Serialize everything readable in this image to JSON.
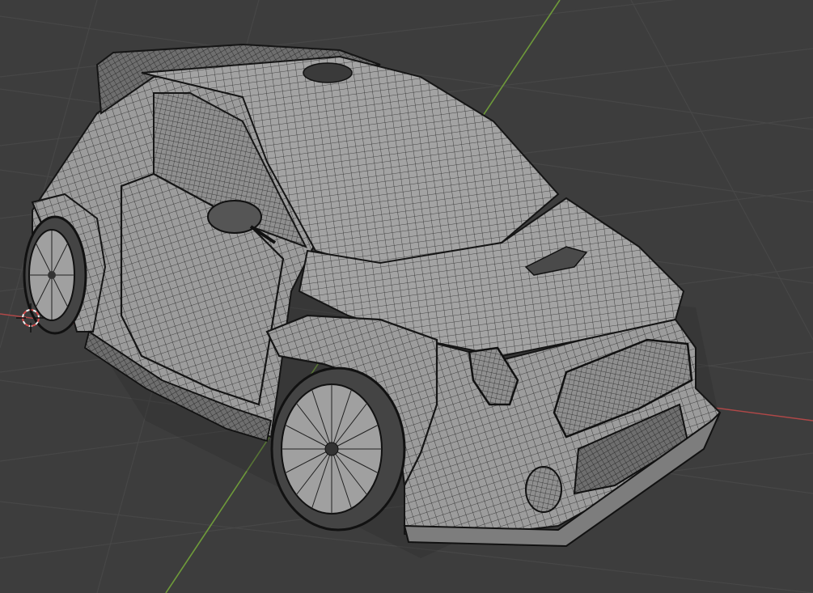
{
  "viewport": {
    "mode": "3d-viewport",
    "shading": "wireframe-overlay-solid",
    "background_color": "#3d3d3d",
    "grid_color": "#4a4a4a",
    "x_axis_color": "#b04848",
    "y_axis_color": "#6e9a3a",
    "model_base_color": "#9a9a9a",
    "wire_color": "#1c1c1c"
  },
  "scene": {
    "object": "car-model",
    "cursor": "3d-cursor-icon"
  }
}
